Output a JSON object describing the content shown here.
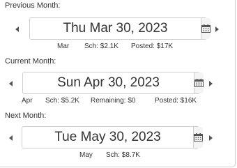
{
  "previous": {
    "label": "Previous Month:",
    "date": "Thu Mar 30, 2023",
    "month": "Mar",
    "sch": "Sch: $2.1K",
    "posted": "Posted: $17K"
  },
  "current": {
    "label": "Current Month:",
    "date": "Sun Apr 30, 2023",
    "month": "Apr",
    "sch": "Sch: $5.2K",
    "remaining": "Remaining: $0",
    "posted": "Posted: $16K"
  },
  "next": {
    "label": "Next Month:",
    "date": "Tue May 30, 2023",
    "month": "May",
    "sch": "Sch: $8.7K"
  },
  "icons": {
    "prev": "caret-left-icon",
    "next": "caret-right-icon",
    "calendar": "calendar-icon"
  },
  "colors": {
    "border": "#cfcfcf",
    "text": "#333333",
    "button_bg": "#f4f4f4",
    "icon": "#555555"
  }
}
